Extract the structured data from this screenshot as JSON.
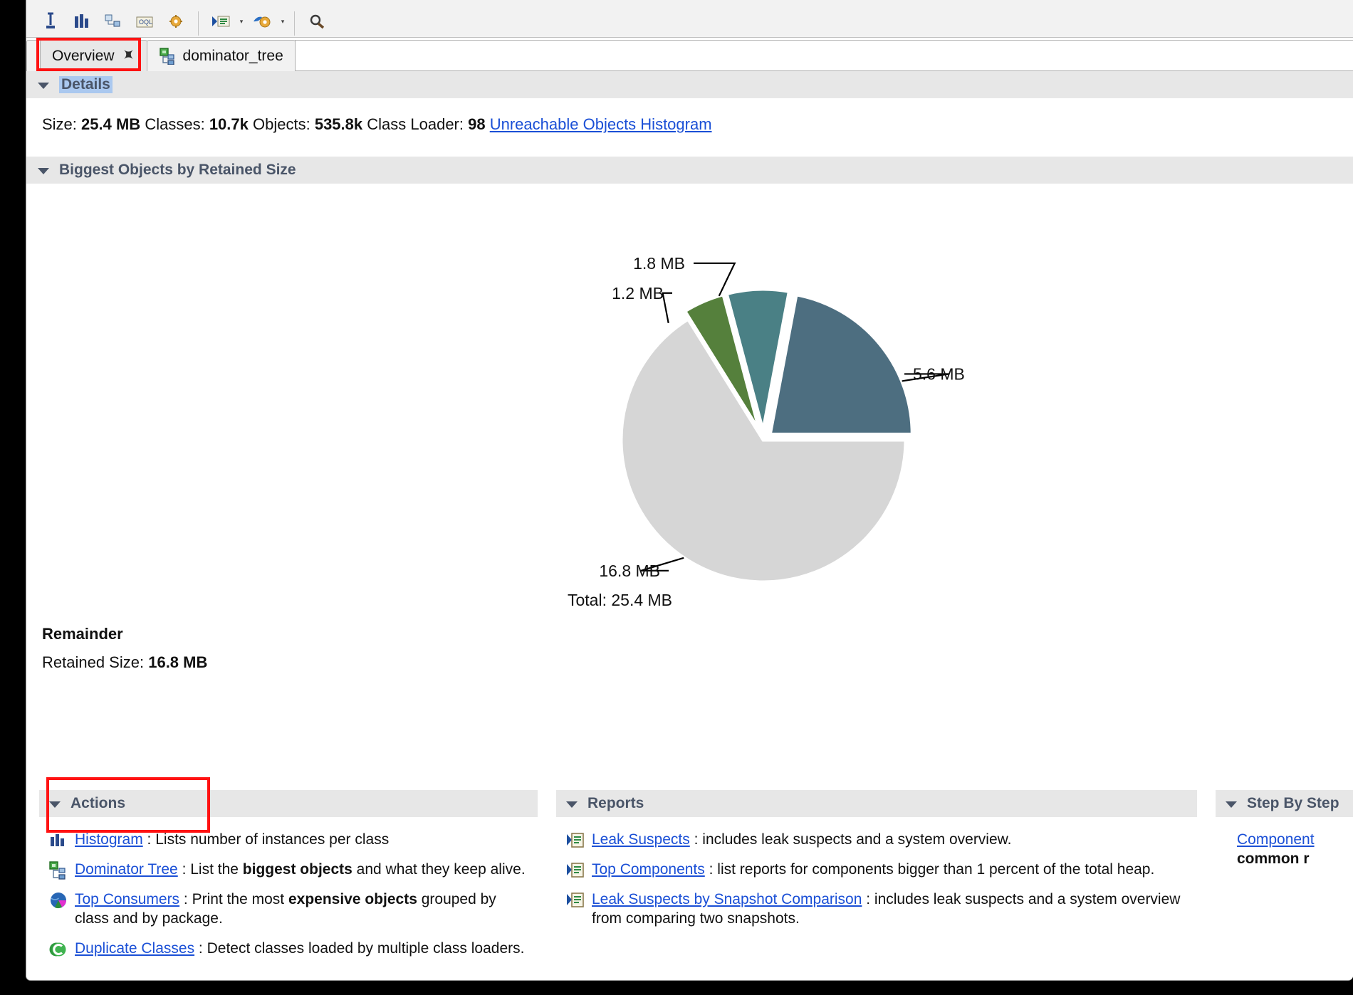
{
  "window": {
    "toolbar_icons": [
      "cursor-icon",
      "histogram-icon",
      "dominator-tree-icon",
      "oql-icon",
      "calculate-retained-size-icon",
      "open-query-browser-icon",
      "inspector-icon",
      "find-icon"
    ]
  },
  "tabs": [
    {
      "label": "Overview",
      "icon": "overview-icon",
      "active": true,
      "closable": true,
      "highlighted": true
    },
    {
      "label": "dominator_tree",
      "icon": "dominator-tree-icon",
      "active": false,
      "closable": false,
      "highlighted": false
    }
  ],
  "details": {
    "header": "Details",
    "size_label": "Size:",
    "size_value": "25.4 MB",
    "classes_label": "Classes:",
    "classes_value": "10.7k",
    "objects_label": "Objects:",
    "objects_value": "535.8k",
    "class_loader_label": "Class Loader:",
    "class_loader_value": "98",
    "unreachable_link": "Unreachable Objects Histogram"
  },
  "biggest_objects": {
    "header": "Biggest Objects by Retained Size"
  },
  "chart_data": {
    "type": "pie",
    "title": "Biggest Objects by Retained Size",
    "total_label": "Total: 25.4 MB",
    "total_value": 25.4,
    "unit": "MB",
    "labels": [
      "5.6 MB",
      "1.8 MB",
      "1.2 MB",
      "16.8 MB"
    ],
    "values": [
      5.6,
      1.8,
      1.2,
      16.8
    ],
    "colors": [
      "#4d6e80",
      "#4a8085",
      "#55803c",
      "#d6d6d6"
    ],
    "exploded": [
      true,
      true,
      true,
      false
    ],
    "legend": "none",
    "grid": false
  },
  "remainder": {
    "title": "Remainder",
    "retained_label": "Retained Size:",
    "retained_value": "16.8 MB"
  },
  "actions": {
    "header": "Actions",
    "items": [
      {
        "icon": "histogram-icon",
        "link": "Histogram",
        "sep": " : ",
        "desc_pre": "Lists number of instances per class",
        "desc_bold": "",
        "desc_post": "",
        "highlighted": false
      },
      {
        "icon": "dominator-tree-icon",
        "link": "Dominator Tree",
        "sep": " : ",
        "desc_pre": "List the ",
        "desc_bold": "biggest objects",
        "desc_post": " and what they keep alive.",
        "highlighted": true
      },
      {
        "icon": "top-consumers-icon",
        "link": "Top Consumers",
        "sep": " : ",
        "desc_pre": "Print the most  ",
        "desc_bold": "expensive objects",
        "desc_post": " grouped by class and by package.",
        "highlighted": false
      },
      {
        "icon": "duplicate-classes-icon",
        "link": "Duplicate Classes",
        "sep": " : ",
        "desc_pre": "Detect classes loaded by multiple class loaders.",
        "desc_bold": "",
        "desc_post": "",
        "highlighted": false
      }
    ]
  },
  "reports": {
    "header": "Reports",
    "items": [
      {
        "icon": "report-icon",
        "link": "Leak Suspects",
        "sep": " : ",
        "desc": "includes leak suspects and a system overview."
      },
      {
        "icon": "report-icon",
        "link": "Top Components",
        "sep": " : ",
        "desc": "list reports for components bigger than 1 percent of the total heap."
      },
      {
        "icon": "report-icon",
        "link": "Leak Suspects by Snapshot Comparison",
        "sep": " : ",
        "desc": "includes leak suspects and a system overview from comparing two snapshots."
      }
    ]
  },
  "step_by_step": {
    "header": "Step By Step",
    "link": "Component",
    "desc_bold": "common r"
  },
  "colors": {
    "link": "#1a4fd6",
    "section_header_bg": "#e7e7e7",
    "section_header_text": "#4a5568",
    "highlight": "#ff1212",
    "title_selection_bg": "#aac8ef"
  }
}
